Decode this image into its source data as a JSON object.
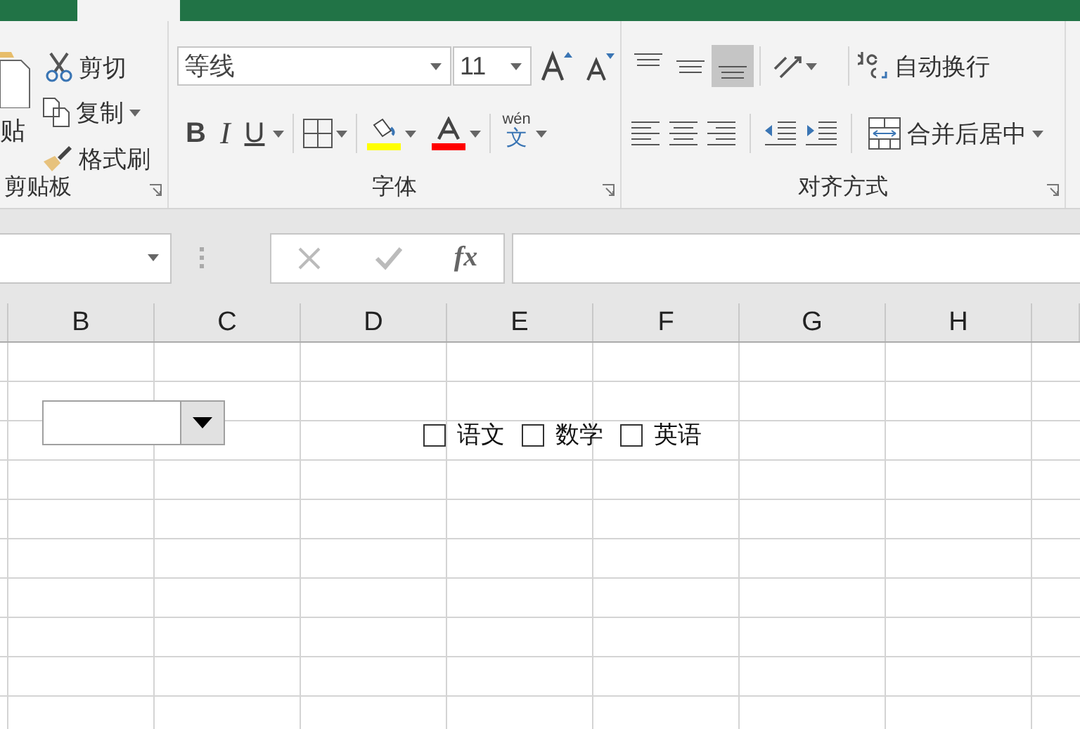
{
  "ribbon": {
    "clipboard": {
      "paste_label": "贴",
      "cut": "剪切",
      "copy": "复制",
      "format_painter": "格式刷",
      "group_label": "剪贴板"
    },
    "font": {
      "font_name": "等线",
      "font_size": "11",
      "style_buttons": [
        {
          "kind": "bold",
          "label": "B"
        },
        {
          "kind": "italic",
          "label": "I"
        },
        {
          "kind": "underline",
          "label": "U"
        }
      ],
      "phonetic_top": "wén",
      "phonetic_char": "文",
      "group_label": "字体"
    },
    "alignment": {
      "vertical_align": [
        {
          "kind": "top",
          "selected": false
        },
        {
          "kind": "middle",
          "selected": false
        },
        {
          "kind": "bottom",
          "selected": true
        }
      ],
      "wrap_text": "自动换行",
      "merge_center": "合并后居中",
      "group_label": "对齐方式"
    }
  },
  "formula_bar": {
    "fx": "fx"
  },
  "columns": [
    "B",
    "C",
    "D",
    "E",
    "F",
    "G",
    "H"
  ],
  "checkboxes": [
    {
      "label": "语文",
      "checked": false
    },
    {
      "label": "数学",
      "checked": false
    },
    {
      "label": "英语",
      "checked": false
    }
  ]
}
